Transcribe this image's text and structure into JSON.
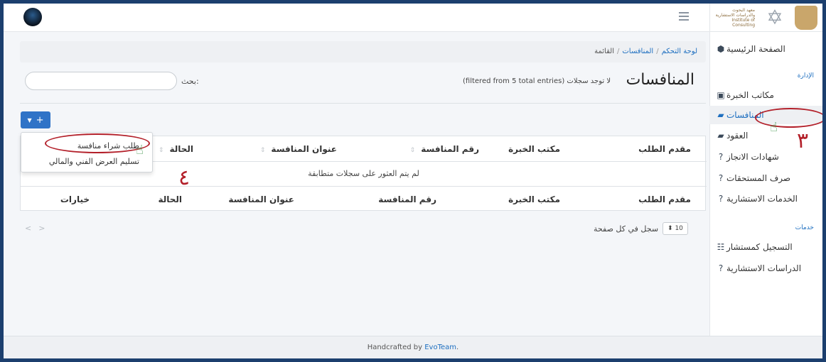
{
  "navbar": {
    "menu_icon": "hamburger-icon",
    "avatar_icon": "avatar-icon"
  },
  "brand": {
    "text": "معهد البحوث والدراسات الاستشارية Institute of Consulting Research and Studies"
  },
  "sidebar": {
    "items_top": [
      {
        "label": "الصفحة الرئيسية",
        "icon": "cube-icon"
      }
    ],
    "section_admin": "الإدارة",
    "items_admin": [
      {
        "label": "مكاتب الخبرة",
        "icon": "briefcase-icon"
      },
      {
        "label": "المنافسات",
        "icon": "folder-open-icon",
        "active": true
      },
      {
        "label": "العقود",
        "icon": "folder-icon"
      },
      {
        "label": "شهادات الانجاز",
        "icon": "question-icon"
      },
      {
        "label": "صرف المستحقات",
        "icon": "question-icon"
      },
      {
        "label": "الخدمات الاستشارية",
        "icon": "question-icon"
      }
    ],
    "section_services": "خدمات",
    "items_services": [
      {
        "label": "التسجيل كمستشار",
        "icon": "list-icon"
      },
      {
        "label": "الدراسات الاستشارية",
        "icon": "question-icon"
      }
    ]
  },
  "breadcrumb": {
    "home": "لوحة التحكم",
    "section": "المنافسات",
    "current": "القائمة",
    "separator": "/"
  },
  "page": {
    "title": "المنافسات",
    "filter_info": "لا توجد سجلات (filtered from 5 total entries)",
    "search_label": "بحث:",
    "search_placeholder": ""
  },
  "add_button": {
    "plus": "+",
    "caret": "▼"
  },
  "dropdown": {
    "items": [
      "طلب شراء منافسة",
      "تسليم العرض الفني والمالي"
    ]
  },
  "table": {
    "headers": [
      "مقدم الطلب",
      "مكتب الخبرة",
      "رقم المنافسة",
      "عنوان المنافسة",
      "الحالة"
    ],
    "footer_headers": [
      "مقدم الطلب",
      "مكتب الخبرة",
      "رقم المنافسة",
      "عنوان المنافسة",
      "الحالة",
      "خيارات"
    ],
    "empty_message": "لم يتم العثور على سجلات متطابقة",
    "sort_glyph": "⇕"
  },
  "pagination": {
    "page_size": "10",
    "page_size_label": "سجل في كل صفحة",
    "prev": "<",
    "next": ">"
  },
  "footer": {
    "prefix": "Handcrafted by ",
    "brand": "EvoTeam",
    "suffix": "."
  },
  "annotations": {
    "step3": "٣",
    "step4": "٤"
  },
  "colors": {
    "accent": "#1e6fc0",
    "button": "#2f73c7",
    "annotation": "#b3202a",
    "frame": "#1c3f6e"
  }
}
